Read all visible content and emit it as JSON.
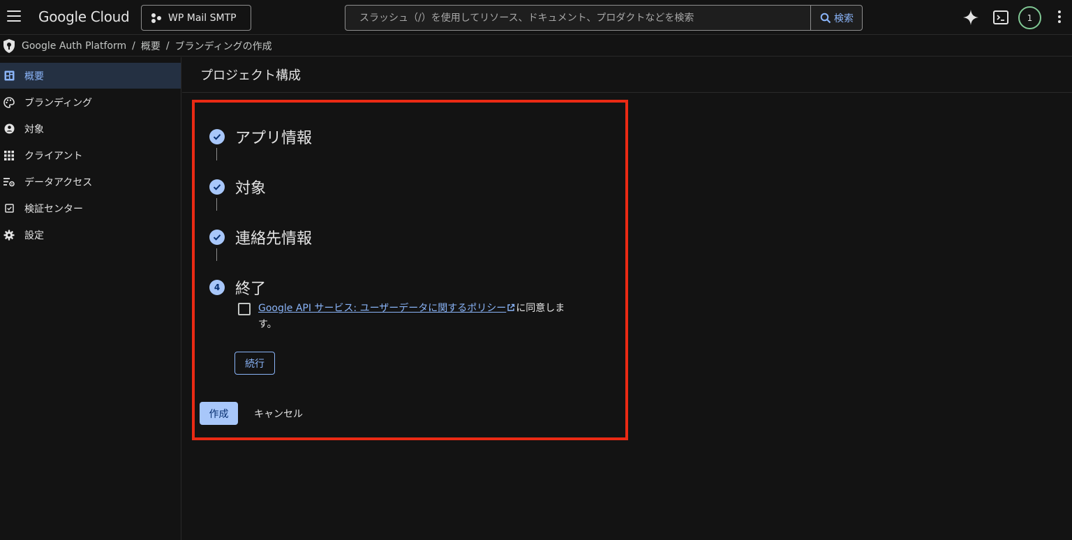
{
  "header": {
    "logo": "Google Cloud",
    "project_name": "WP Mail SMTP",
    "search_placeholder": "スラッシュ（/）を使用してリソース、ドキュメント、プロダクトなどを検索",
    "search_button": "検索",
    "notification_count": "1",
    "icons": [
      "menu-icon",
      "project-icon",
      "search-icon",
      "gemini-spark-icon",
      "cloud-shell-icon",
      "more-vert-icon"
    ]
  },
  "breadcrumb": {
    "items": [
      "Google Auth Platform",
      "概要",
      "ブランディングの作成"
    ],
    "separator": "/"
  },
  "sidebar": {
    "items": [
      {
        "label": "概要",
        "icon": "dashboard-icon",
        "active": true
      },
      {
        "label": "ブランディング",
        "icon": "palette-icon",
        "active": false
      },
      {
        "label": "対象",
        "icon": "person-icon",
        "active": false
      },
      {
        "label": "クライアント",
        "icon": "grid-icon",
        "active": false
      },
      {
        "label": "データアクセス",
        "icon": "data-settings-icon",
        "active": false
      },
      {
        "label": "検証センター",
        "icon": "checklist-icon",
        "active": false
      },
      {
        "label": "設定",
        "icon": "gear-icon",
        "active": false
      }
    ]
  },
  "main": {
    "page_title": "プロジェクト構成",
    "steps": [
      {
        "label": "アプリ情報",
        "status": "done"
      },
      {
        "label": "対象",
        "status": "done"
      },
      {
        "label": "連絡先情報",
        "status": "done"
      },
      {
        "label": "終了",
        "status": "current",
        "number": "4"
      }
    ],
    "consent": {
      "link_text": "Google API サービス: ユーザーデータに関するポリシー",
      "suffix": "に同意します。",
      "checked": false
    },
    "continue_button": "続行",
    "create_button": "作成",
    "cancel_button": "キャンセル"
  },
  "colors": {
    "background": "#131313",
    "accent": "#8ab4f8",
    "step_circle": "#a8c7fa",
    "highlight_border": "#ea2a14",
    "active_nav_bg": "#243042"
  }
}
